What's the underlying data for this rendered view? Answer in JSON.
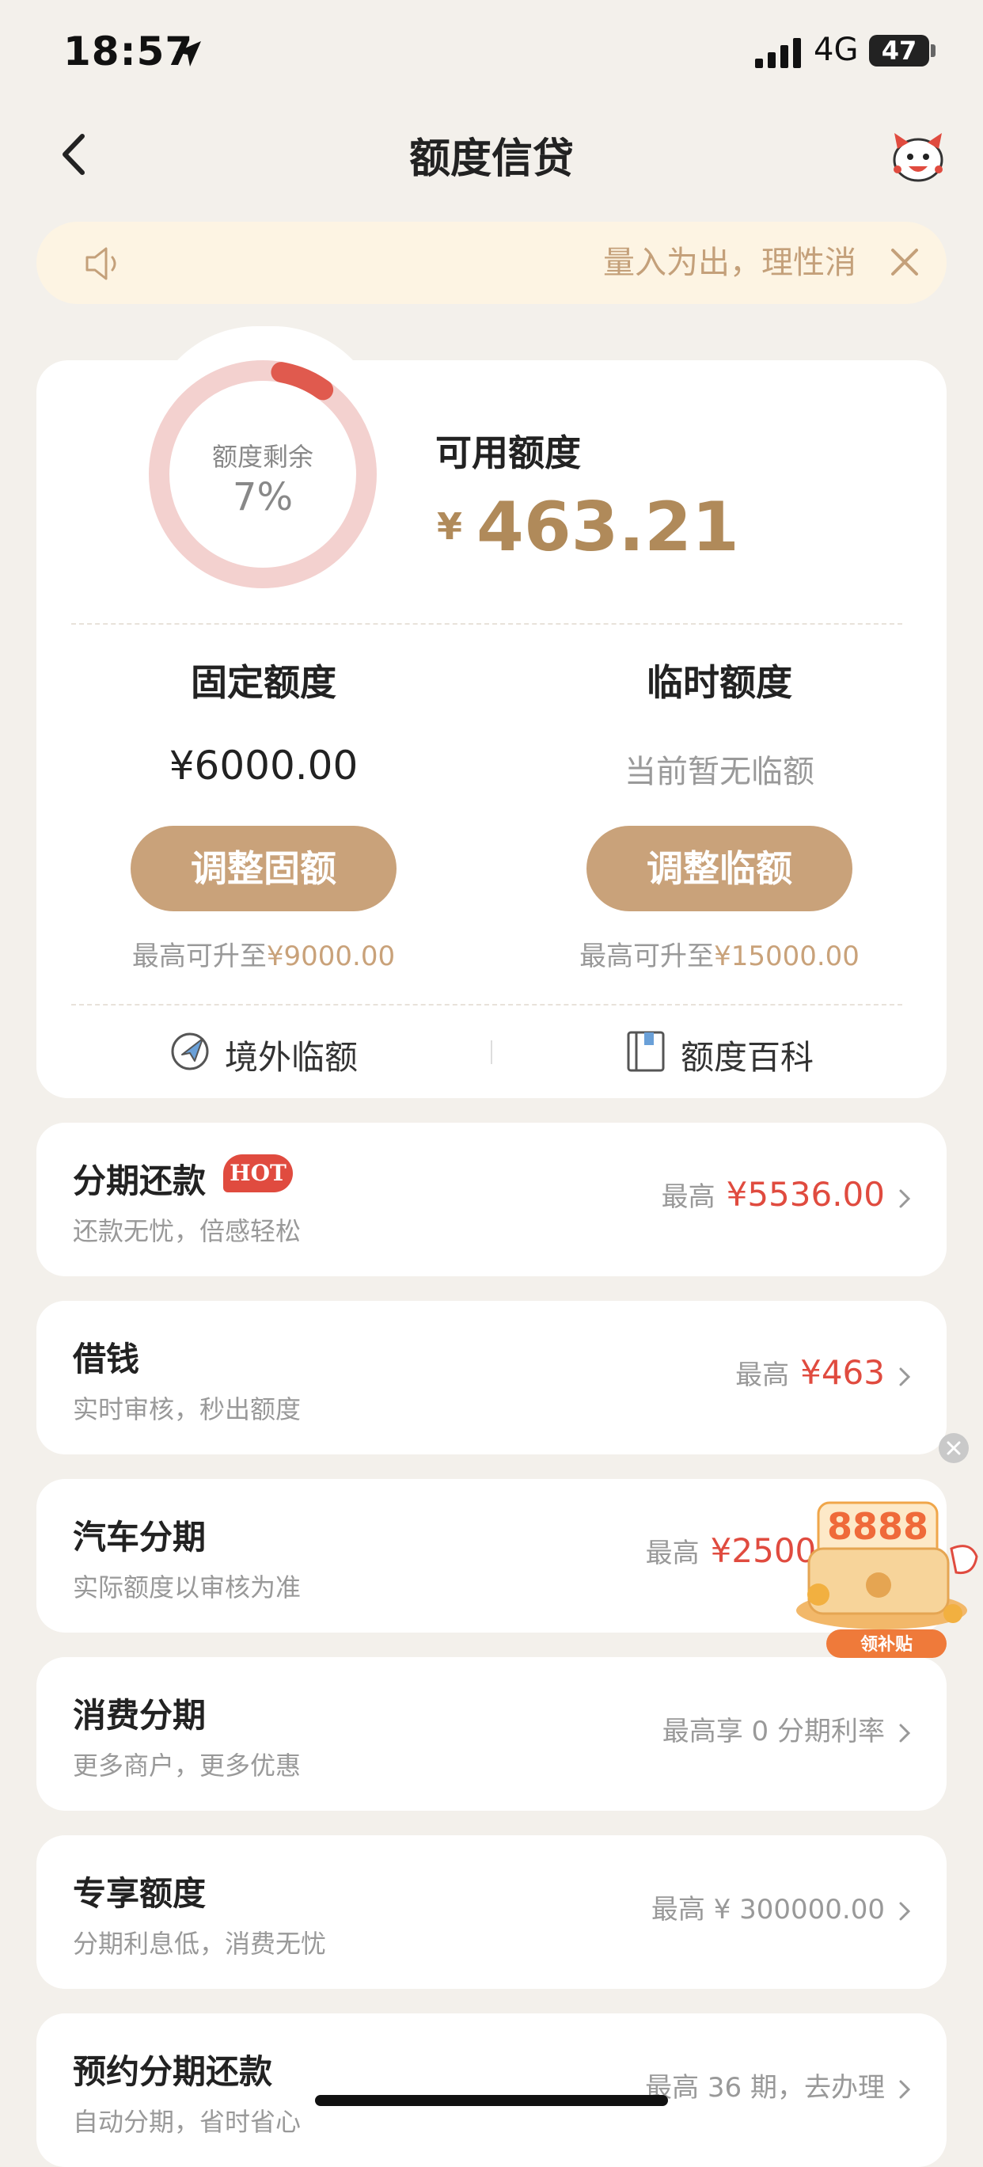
{
  "status_bar": {
    "time": "18:57",
    "network": "4G",
    "battery": "47"
  },
  "nav": {
    "title": "额度信贷"
  },
  "notice": {
    "text": "量入为出，理性消费"
  },
  "credit": {
    "ring_label": "额度剩余",
    "ring_percent_text": "7%",
    "remaining_fraction": 0.07,
    "available_label": "可用额度",
    "currency": "¥",
    "available_value": "463.21",
    "fixed": {
      "title": "固定额度",
      "value": "¥6000.00",
      "button": "调整固额",
      "upto_prefix": "最高可升至",
      "upto_amount": "¥9000.00"
    },
    "temporary": {
      "title": "临时额度",
      "value": "当前暂无临额",
      "button": "调整临额",
      "upto_prefix": "最高可升至",
      "upto_amount": "¥15000.00"
    },
    "links": [
      "境外临额",
      "额度百科"
    ]
  },
  "products": [
    {
      "title": "分期还款",
      "badge": "HOT",
      "subtitle": "还款无忧，倍感轻松",
      "prefix": "最高",
      "amount": "¥5536.00"
    },
    {
      "title": "借钱",
      "subtitle": "实时审核，秒出额度",
      "prefix": "最高",
      "amount": "¥463"
    },
    {
      "title": "汽车分期",
      "subtitle": "实际额度以审核为准",
      "prefix": "最高",
      "amount": "¥25000"
    },
    {
      "title": "消费分期",
      "subtitle": "更多商户，更多优惠",
      "prefix": "最高享 0 分期利率",
      "amount": ""
    },
    {
      "title": "专享额度",
      "subtitle": "分期利息低，消费无忧",
      "prefix": "最高 ¥ 300000.00",
      "amount": ""
    },
    {
      "title": "预约分期还款",
      "subtitle": "自动分期，省时省心",
      "prefix": "最高 36 期，去办理",
      "amount": ""
    }
  ],
  "promo": {
    "number": "8888",
    "button": "领补贴"
  },
  "colors": {
    "accent_gold": "#c9a27a",
    "red": "#e04b3f",
    "ring_track": "#f3d1cf",
    "ring_fill": "#e05a4e"
  }
}
